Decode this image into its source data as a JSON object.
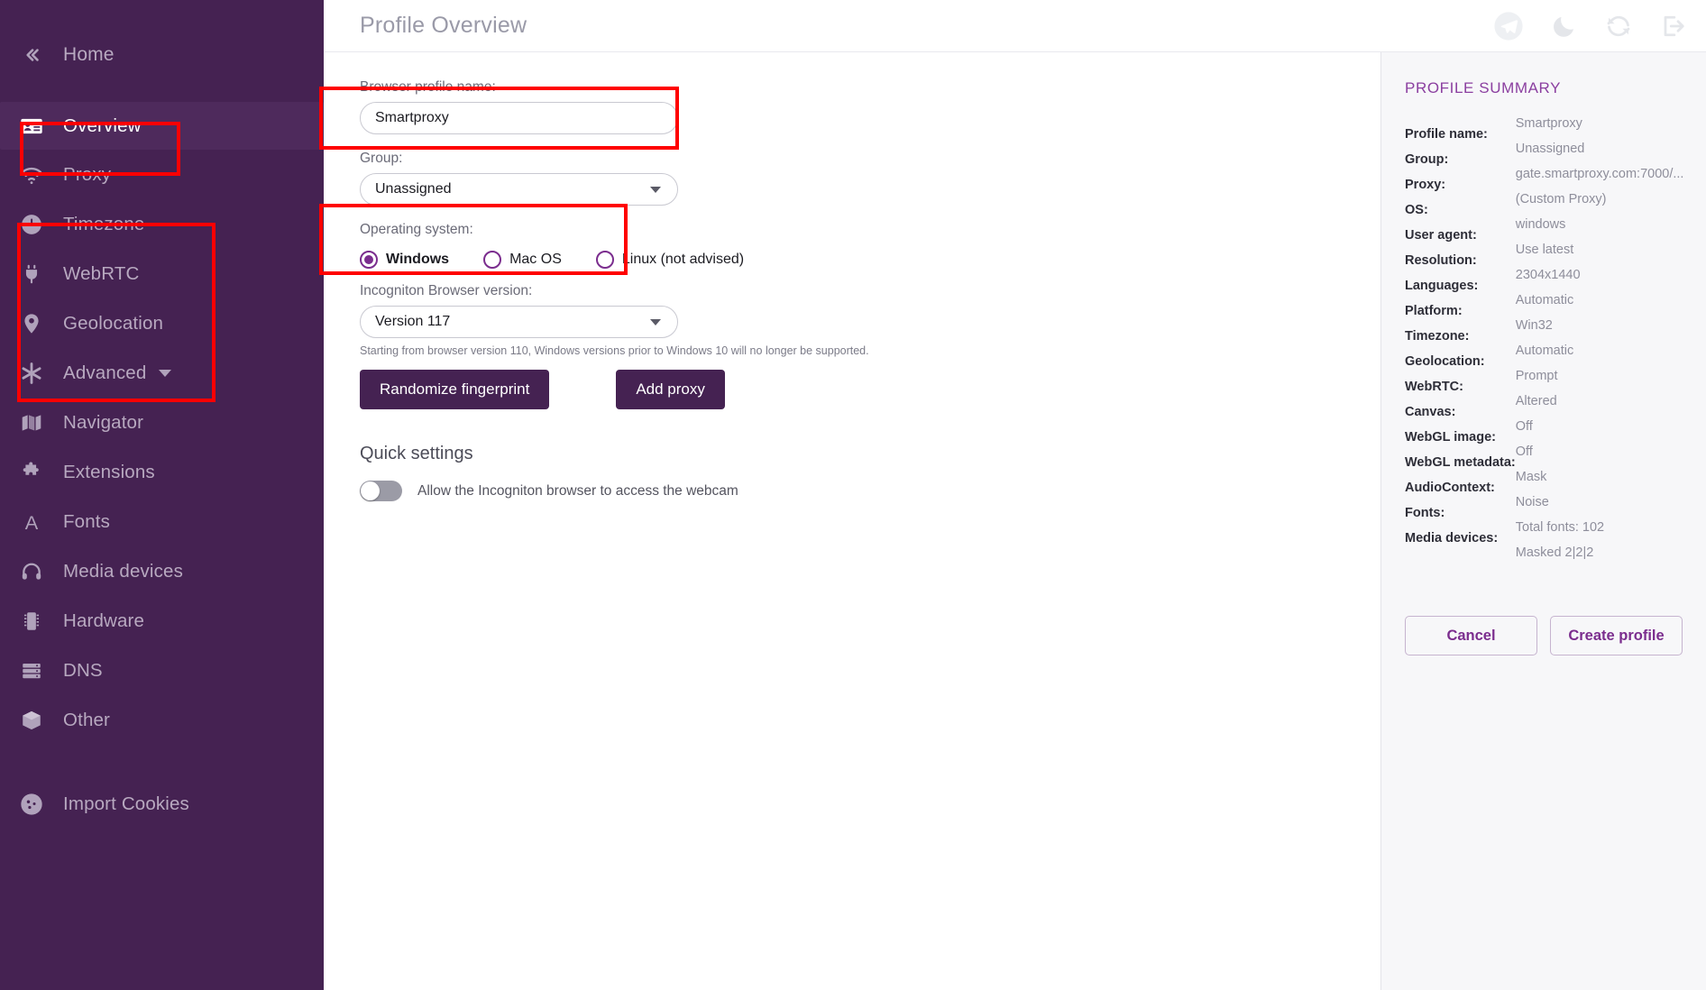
{
  "sidebar": {
    "collapse_icon": "double-chevron-left-icon",
    "home_label": "Home",
    "items": [
      {
        "label": "Overview",
        "icon": "id-card-icon",
        "active": true
      },
      {
        "label": "Proxy",
        "icon": "wifi-icon",
        "active": false
      },
      {
        "label": "Timezone",
        "icon": "clock-icon",
        "active": false
      },
      {
        "label": "WebRTC",
        "icon": "plug-icon",
        "active": false
      },
      {
        "label": "Geolocation",
        "icon": "map-pin-icon",
        "active": false
      },
      {
        "label": "Advanced",
        "icon": "asterisk-icon",
        "active": false,
        "has_caret": true
      },
      {
        "label": "Navigator",
        "icon": "map-icon",
        "active": false
      },
      {
        "label": "Extensions",
        "icon": "puzzle-icon",
        "active": false
      },
      {
        "label": "Fonts",
        "icon": "letter-a-icon",
        "active": false
      },
      {
        "label": "Media devices",
        "icon": "headphones-icon",
        "active": false
      },
      {
        "label": "Hardware",
        "icon": "chip-icon",
        "active": false
      },
      {
        "label": "DNS",
        "icon": "server-icon",
        "active": false
      },
      {
        "label": "Other",
        "icon": "box-icon",
        "active": false
      }
    ],
    "import_cookies_label": "Import Cookies",
    "import_cookies_icon": "cookie-icon"
  },
  "header": {
    "title": "Profile Overview",
    "icons": [
      "telegram-icon",
      "moon-icon",
      "refresh-icon",
      "logout-icon"
    ]
  },
  "form": {
    "profile_name_label": "Browser profile name:",
    "profile_name_value": "Smartproxy",
    "profile_name_placeholder": "Browser profile name",
    "group_label": "Group:",
    "group_value": "Unassigned",
    "os_label": "Operating system:",
    "os_options": [
      {
        "label": "Windows",
        "selected": true
      },
      {
        "label": "Mac OS",
        "selected": false
      },
      {
        "label": "Linux (not advised)",
        "selected": false
      }
    ],
    "version_label": "Incogniton Browser version:",
    "version_value": "Version 117",
    "version_hint": "Starting from browser version 110, Windows versions prior to Windows 10 will no longer be supported.",
    "randomize_button": "Randomize fingerprint",
    "add_proxy_button": "Add proxy",
    "quick_settings_title": "Quick settings",
    "webcam_toggle_label": "Allow the Incogniton browser to access the webcam",
    "webcam_toggle_on": false
  },
  "summary": {
    "title": "PROFILE SUMMARY",
    "labels": [
      "Profile name:",
      "Group:",
      "Proxy:",
      "OS:",
      "User agent:",
      "Resolution:",
      "Languages:",
      "Platform:",
      "Timezone:",
      "Geolocation:",
      "WebRTC:",
      "Canvas:",
      "WebGL image:",
      "WebGL metadata:",
      "AudioContext:",
      "Fonts:",
      "Media devices:"
    ],
    "values": [
      "Smartproxy",
      "Unassigned",
      "gate.smartproxy.com:7000/...",
      "(Custom Proxy)",
      "windows",
      "Use latest",
      "2304x1440",
      "Automatic",
      "Win32",
      "Automatic",
      "Prompt",
      "Altered",
      "Off",
      "Off",
      "Mask",
      "Noise",
      "Total fonts: 102",
      "Masked 2|2|2"
    ],
    "cancel_button": "Cancel",
    "create_button": "Create profile"
  },
  "colors": {
    "sidebar_bg": "#452252",
    "accent_purple": "#7b2d8e",
    "annotation_red": "#ff0000",
    "panel_bg": "#f7f7f9"
  }
}
